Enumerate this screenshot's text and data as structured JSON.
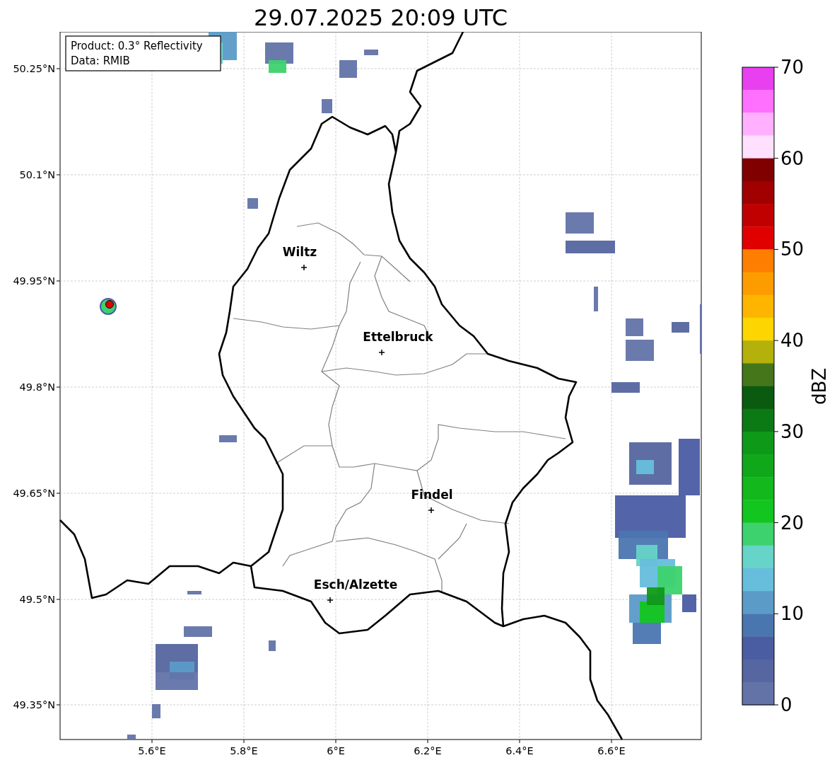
{
  "title": "29.07.2025 20:09 UTC",
  "info_box": {
    "lines": [
      "Product: 0.3° Reflectivity",
      "Data: RMIB"
    ]
  },
  "x_ticks": [
    "5.6°E",
    "5.8°E",
    "6°E",
    "6.2°E",
    "6.4°E",
    "6.6°E"
  ],
  "y_ticks": [
    "50.25°N",
    "50.1°N",
    "49.95°N",
    "49.8°N",
    "49.65°N",
    "49.5°N",
    "49.35°N"
  ],
  "cities": [
    {
      "name": "Wiltz"
    },
    {
      "name": "Ettelbruck"
    },
    {
      "name": "Findel"
    },
    {
      "name": "Esch/Alzette"
    }
  ],
  "colorbar": {
    "label": "dBZ",
    "ticks": [
      "70",
      "60",
      "50",
      "40",
      "30",
      "20",
      "10",
      "0"
    ],
    "bins": [
      {
        "color": "#e840f0"
      },
      {
        "color": "#ff70ff"
      },
      {
        "color": "#ffb0ff"
      },
      {
        "color": "#ffe0ff"
      },
      {
        "color": "#800000"
      },
      {
        "color": "#a00000"
      },
      {
        "color": "#c00000"
      },
      {
        "color": "#e00000"
      },
      {
        "color": "#fd7e00"
      },
      {
        "color": "#fd9c00"
      },
      {
        "color": "#fdb500"
      },
      {
        "color": "#fdd500"
      },
      {
        "color": "#b3b10a"
      },
      {
        "color": "#45761a"
      },
      {
        "color": "#0a5a10"
      },
      {
        "color": "#0c7a14"
      },
      {
        "color": "#0f9918"
      },
      {
        "color": "#10a81a"
      },
      {
        "color": "#12b81c"
      },
      {
        "color": "#12c61f"
      },
      {
        "color": "#3dd26e"
      },
      {
        "color": "#66d4c8"
      },
      {
        "color": "#66bedc"
      },
      {
        "color": "#5a9bc8"
      },
      {
        "color": "#4a76b0"
      },
      {
        "color": "#4a5da3"
      },
      {
        "color": "#5566a0"
      },
      {
        "color": "#6373a8"
      }
    ]
  }
}
